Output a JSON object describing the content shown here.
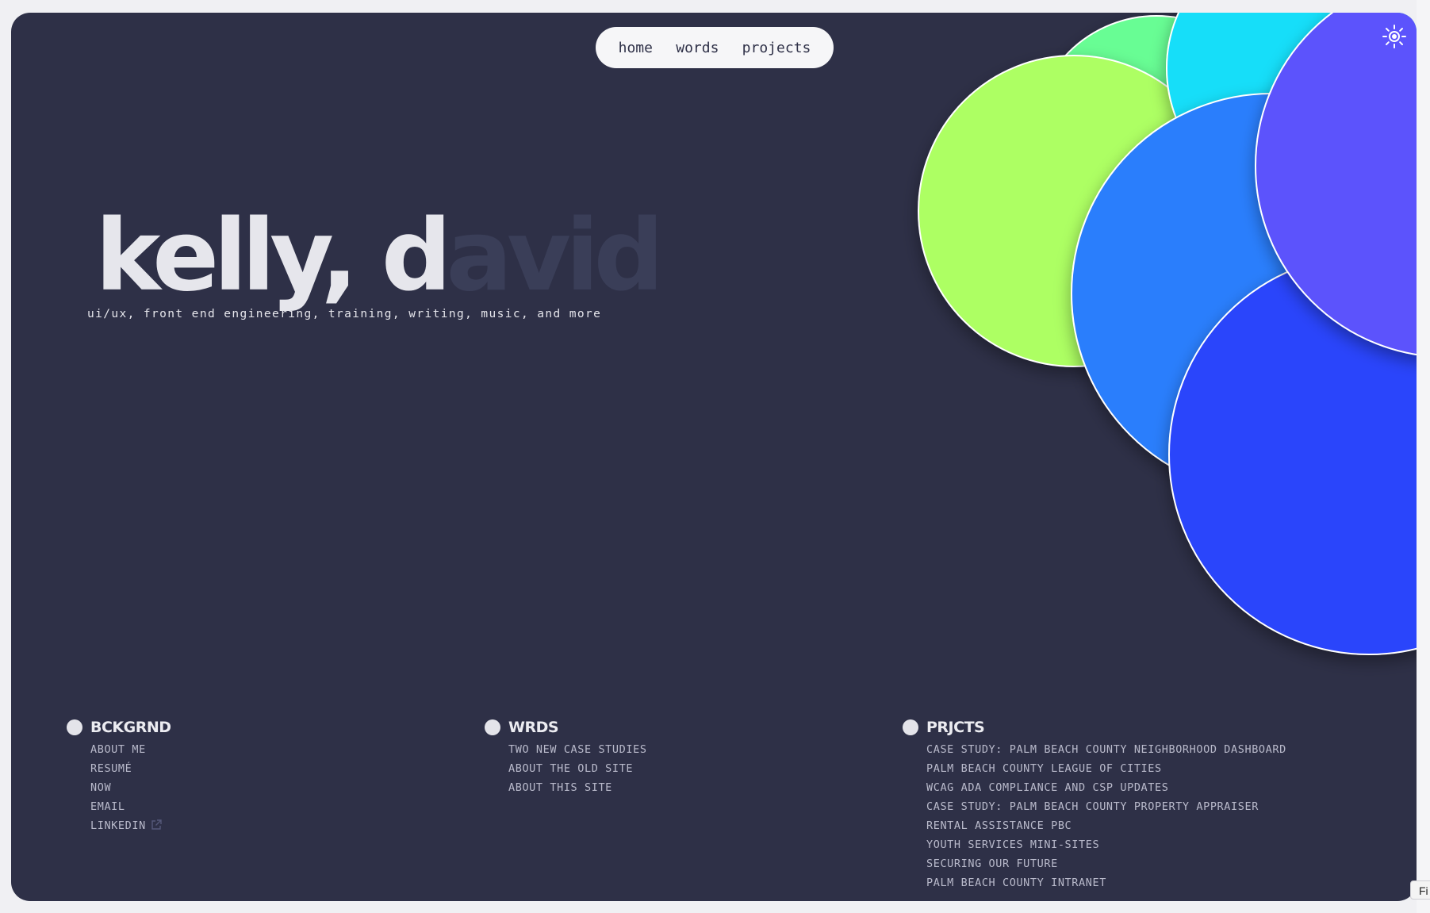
{
  "nav": {
    "items": [
      {
        "label": "home"
      },
      {
        "label": "words"
      },
      {
        "label": "projects"
      }
    ]
  },
  "theme_toggle": {
    "icon": "sun-icon"
  },
  "hero": {
    "name_lit": "kelly, d",
    "name_dim": "avid",
    "tagline": "ui/ux, front end engineering, training, writing, music, and more"
  },
  "colors": {
    "background": "#2e3047",
    "text": "#e6e6ec",
    "dim_text": "#3a3e58",
    "link": "#b9bacb",
    "bubble_lime": "#adff63",
    "bubble_mint": "#68fd94",
    "bubble_cyan": "#12def9",
    "bubble_blue": "#2a7efc",
    "bubble_violet": "#5b52fc",
    "bubble_royal": "#2a45fb"
  },
  "footer": {
    "columns": [
      {
        "title": "BCKGRND",
        "links": [
          "ABOUT ME",
          "RESUMÉ",
          "NOW",
          "EMAIL",
          "LINKEDIN"
        ]
      },
      {
        "title": "WRDS",
        "links": [
          "TWO NEW CASE STUDIES",
          "ABOUT THE OLD SITE",
          "ABOUT THIS SITE"
        ]
      },
      {
        "title": "PRJCTS",
        "links": [
          "CASE STUDY: PALM BEACH COUNTY NEIGHBORHOOD DASHBOARD",
          "PALM BEACH COUNTY LEAGUE OF CITIES",
          "WCAG ADA COMPLIANCE AND CSP UPDATES",
          "CASE STUDY: PALM BEACH COUNTY PROPERTY APPRAISER",
          "RENTAL ASSISTANCE PBC",
          "YOUTH SERVICES MINI-SITES",
          "SECURING OUR FUTURE",
          "PALM BEACH COUNTY INTRANET"
        ]
      }
    ]
  },
  "find_bar": {
    "label": "Fi"
  }
}
